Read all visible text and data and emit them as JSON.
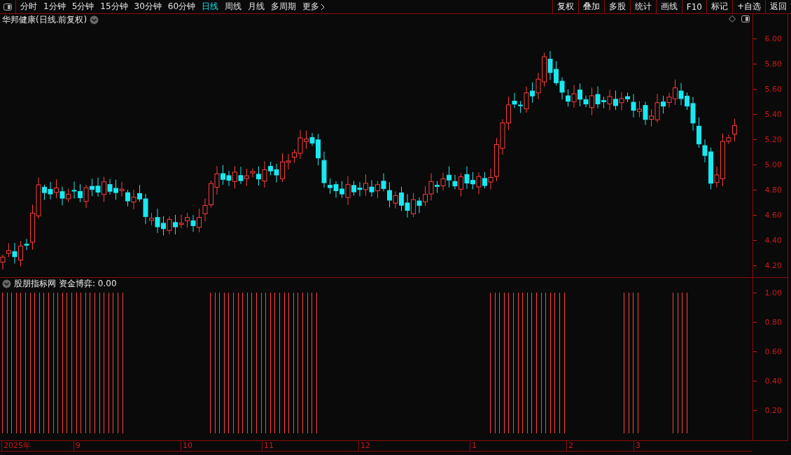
{
  "toolbar": {
    "periods": [
      {
        "label": "分时",
        "selected": false
      },
      {
        "label": "1分钟",
        "selected": false
      },
      {
        "label": "5分钟",
        "selected": false
      },
      {
        "label": "15分钟",
        "selected": false
      },
      {
        "label": "30分钟",
        "selected": false
      },
      {
        "label": "60分钟",
        "selected": false
      },
      {
        "label": "日线",
        "selected": true
      },
      {
        "label": "周线",
        "selected": false
      },
      {
        "label": "月线",
        "selected": false
      },
      {
        "label": "多周期",
        "selected": false
      },
      {
        "label": "更多",
        "selected": false
      }
    ],
    "buttons": [
      "复权",
      "叠加",
      "多股",
      "统计",
      "画线",
      "F10",
      "标记",
      "+自选",
      "返回"
    ]
  },
  "chart": {
    "title": "华邦健康(日线.前复权)",
    "price_axis": [
      "6.00",
      "5.80",
      "5.60",
      "5.40",
      "5.20",
      "5.00",
      "4.80",
      "4.60",
      "4.40",
      "4.20"
    ]
  },
  "indicator": {
    "name": "股朋指标网",
    "reading": "资金博弈: 0.00",
    "axis": [
      "1.00",
      "0.80",
      "0.60",
      "0.40",
      "0.20"
    ]
  },
  "time_axis": [
    "2025年",
    "9",
    "10",
    "11",
    "12",
    "1",
    "2",
    "3"
  ]
}
